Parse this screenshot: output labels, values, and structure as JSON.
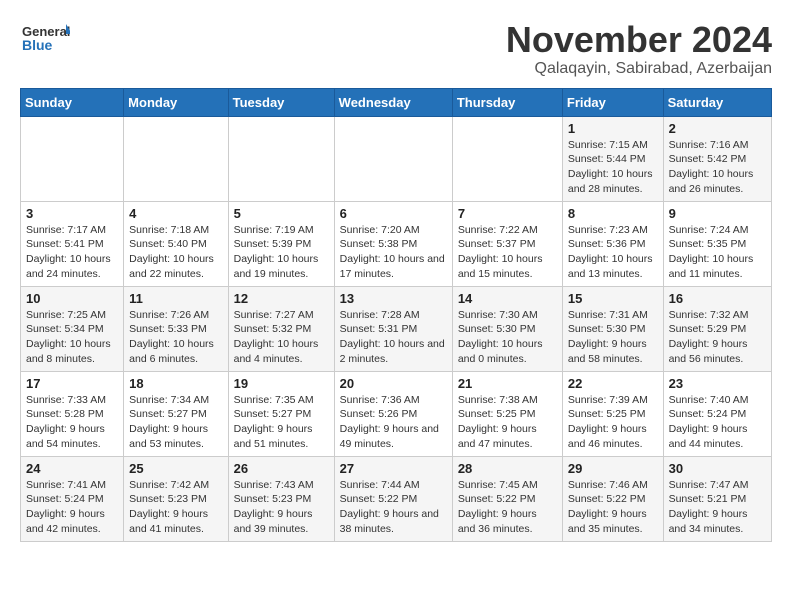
{
  "header": {
    "logo_line1": "General",
    "logo_line2": "Blue",
    "month_year": "November 2024",
    "location": "Qalaqayin, Sabirabad, Azerbaijan"
  },
  "weekdays": [
    "Sunday",
    "Monday",
    "Tuesday",
    "Wednesday",
    "Thursday",
    "Friday",
    "Saturday"
  ],
  "weeks": [
    [
      {
        "day": "",
        "info": ""
      },
      {
        "day": "",
        "info": ""
      },
      {
        "day": "",
        "info": ""
      },
      {
        "day": "",
        "info": ""
      },
      {
        "day": "",
        "info": ""
      },
      {
        "day": "1",
        "info": "Sunrise: 7:15 AM\nSunset: 5:44 PM\nDaylight: 10 hours and 28 minutes."
      },
      {
        "day": "2",
        "info": "Sunrise: 7:16 AM\nSunset: 5:42 PM\nDaylight: 10 hours and 26 minutes."
      }
    ],
    [
      {
        "day": "3",
        "info": "Sunrise: 7:17 AM\nSunset: 5:41 PM\nDaylight: 10 hours and 24 minutes."
      },
      {
        "day": "4",
        "info": "Sunrise: 7:18 AM\nSunset: 5:40 PM\nDaylight: 10 hours and 22 minutes."
      },
      {
        "day": "5",
        "info": "Sunrise: 7:19 AM\nSunset: 5:39 PM\nDaylight: 10 hours and 19 minutes."
      },
      {
        "day": "6",
        "info": "Sunrise: 7:20 AM\nSunset: 5:38 PM\nDaylight: 10 hours and 17 minutes."
      },
      {
        "day": "7",
        "info": "Sunrise: 7:22 AM\nSunset: 5:37 PM\nDaylight: 10 hours and 15 minutes."
      },
      {
        "day": "8",
        "info": "Sunrise: 7:23 AM\nSunset: 5:36 PM\nDaylight: 10 hours and 13 minutes."
      },
      {
        "day": "9",
        "info": "Sunrise: 7:24 AM\nSunset: 5:35 PM\nDaylight: 10 hours and 11 minutes."
      }
    ],
    [
      {
        "day": "10",
        "info": "Sunrise: 7:25 AM\nSunset: 5:34 PM\nDaylight: 10 hours and 8 minutes."
      },
      {
        "day": "11",
        "info": "Sunrise: 7:26 AM\nSunset: 5:33 PM\nDaylight: 10 hours and 6 minutes."
      },
      {
        "day": "12",
        "info": "Sunrise: 7:27 AM\nSunset: 5:32 PM\nDaylight: 10 hours and 4 minutes."
      },
      {
        "day": "13",
        "info": "Sunrise: 7:28 AM\nSunset: 5:31 PM\nDaylight: 10 hours and 2 minutes."
      },
      {
        "day": "14",
        "info": "Sunrise: 7:30 AM\nSunset: 5:30 PM\nDaylight: 10 hours and 0 minutes."
      },
      {
        "day": "15",
        "info": "Sunrise: 7:31 AM\nSunset: 5:30 PM\nDaylight: 9 hours and 58 minutes."
      },
      {
        "day": "16",
        "info": "Sunrise: 7:32 AM\nSunset: 5:29 PM\nDaylight: 9 hours and 56 minutes."
      }
    ],
    [
      {
        "day": "17",
        "info": "Sunrise: 7:33 AM\nSunset: 5:28 PM\nDaylight: 9 hours and 54 minutes."
      },
      {
        "day": "18",
        "info": "Sunrise: 7:34 AM\nSunset: 5:27 PM\nDaylight: 9 hours and 53 minutes."
      },
      {
        "day": "19",
        "info": "Sunrise: 7:35 AM\nSunset: 5:27 PM\nDaylight: 9 hours and 51 minutes."
      },
      {
        "day": "20",
        "info": "Sunrise: 7:36 AM\nSunset: 5:26 PM\nDaylight: 9 hours and 49 minutes."
      },
      {
        "day": "21",
        "info": "Sunrise: 7:38 AM\nSunset: 5:25 PM\nDaylight: 9 hours and 47 minutes."
      },
      {
        "day": "22",
        "info": "Sunrise: 7:39 AM\nSunset: 5:25 PM\nDaylight: 9 hours and 46 minutes."
      },
      {
        "day": "23",
        "info": "Sunrise: 7:40 AM\nSunset: 5:24 PM\nDaylight: 9 hours and 44 minutes."
      }
    ],
    [
      {
        "day": "24",
        "info": "Sunrise: 7:41 AM\nSunset: 5:24 PM\nDaylight: 9 hours and 42 minutes."
      },
      {
        "day": "25",
        "info": "Sunrise: 7:42 AM\nSunset: 5:23 PM\nDaylight: 9 hours and 41 minutes."
      },
      {
        "day": "26",
        "info": "Sunrise: 7:43 AM\nSunset: 5:23 PM\nDaylight: 9 hours and 39 minutes."
      },
      {
        "day": "27",
        "info": "Sunrise: 7:44 AM\nSunset: 5:22 PM\nDaylight: 9 hours and 38 minutes."
      },
      {
        "day": "28",
        "info": "Sunrise: 7:45 AM\nSunset: 5:22 PM\nDaylight: 9 hours and 36 minutes."
      },
      {
        "day": "29",
        "info": "Sunrise: 7:46 AM\nSunset: 5:22 PM\nDaylight: 9 hours and 35 minutes."
      },
      {
        "day": "30",
        "info": "Sunrise: 7:47 AM\nSunset: 5:21 PM\nDaylight: 9 hours and 34 minutes."
      }
    ]
  ]
}
